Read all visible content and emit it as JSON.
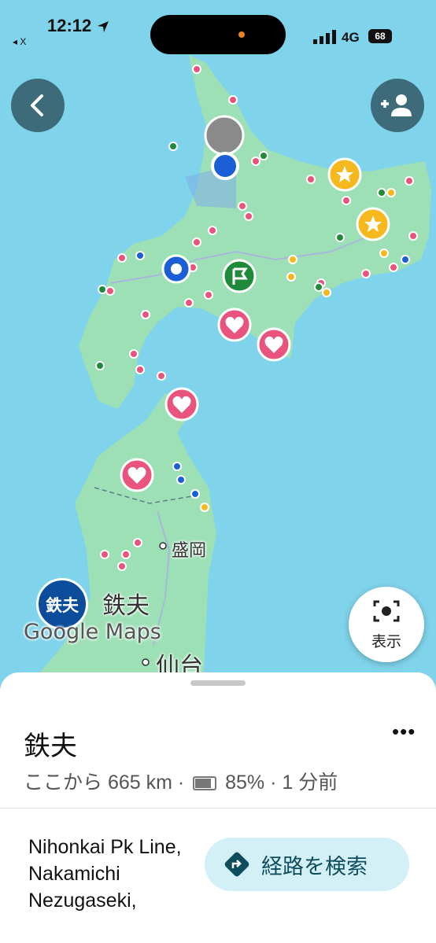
{
  "status_bar": {
    "time": "12:12",
    "back_app": "◂ X",
    "network": "4G",
    "battery": "68"
  },
  "map": {
    "city_labels": [
      "盛岡",
      "仙台"
    ],
    "person_avatar_text": "鉄夫",
    "person_label": "鉄夫",
    "watermark": "Google Maps"
  },
  "buttons": {
    "lens_label": "表示"
  },
  "sheet": {
    "title": "鉄夫",
    "meta_prefix": "ここから 665 km ·",
    "meta_battery": "85% · 1 分前",
    "address": "Nihonkai Pk Line, Nakamichi Nezugaseki,",
    "route_label": "経路を検索",
    "more_label": "•••"
  },
  "colors": {
    "sea": "#7fd3ea",
    "land": "#9ee0b6",
    "pin_pink": "#e9547e",
    "pin_green": "#1f8a3a",
    "pin_yellow": "#f5b81e",
    "pin_blue": "#1b5fd6"
  }
}
